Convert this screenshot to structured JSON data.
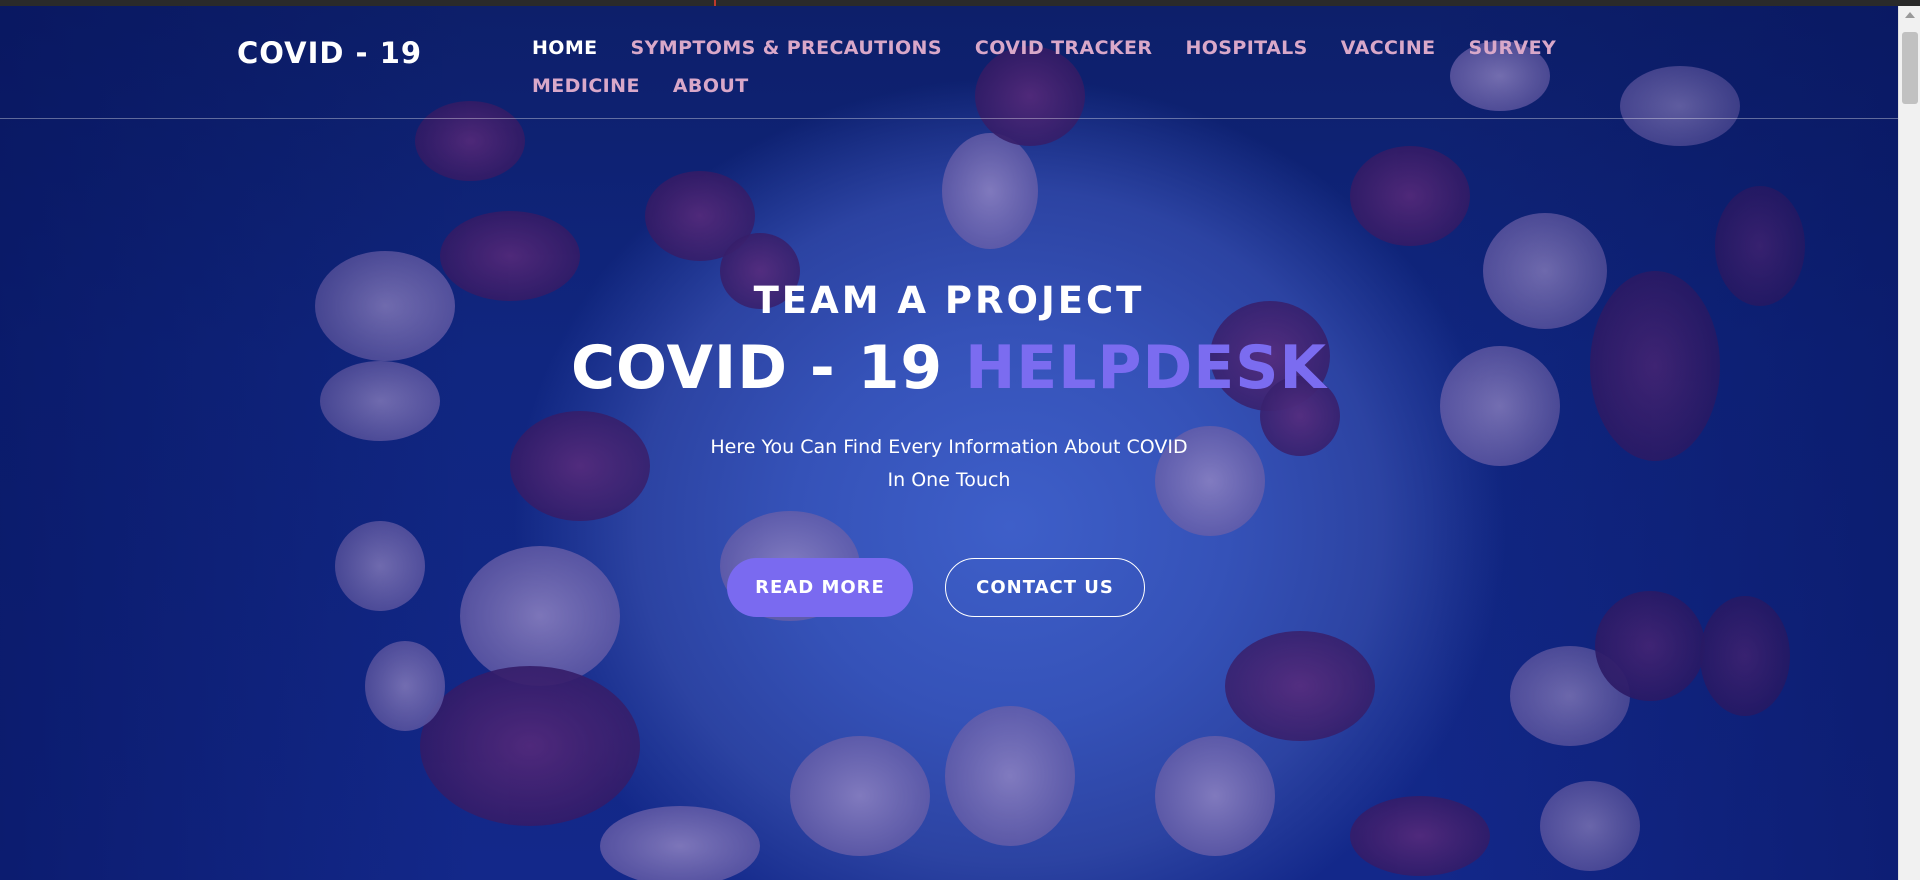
{
  "nav": {
    "brand": "COVID - 19",
    "items": [
      {
        "label": "HOME",
        "active": true
      },
      {
        "label": "SYMPTOMS & PRECAUTIONS",
        "active": false
      },
      {
        "label": "COVID TRACKER",
        "active": false
      },
      {
        "label": "HOSPITALS",
        "active": false
      },
      {
        "label": "VACCINE",
        "active": false
      },
      {
        "label": "SURVEY",
        "active": false
      },
      {
        "label": "MEDICINE",
        "active": false
      },
      {
        "label": "ABOUT",
        "active": false
      }
    ]
  },
  "hero": {
    "eyebrow": "TEAM A PROJECT",
    "headline_main": "COVID - 19 ",
    "headline_accent": "HELPDESK",
    "tagline_line1": "Here You Can Find Every Information About COVID",
    "tagline_line2": "In One Touch",
    "primary_button": "READ MORE",
    "secondary_button": "CONTACT US"
  },
  "colors": {
    "background": "#13288a",
    "accent": "#7b6cf0",
    "nav_link": "#d9a8c9",
    "nav_active": "#ffffff"
  },
  "icons": {
    "scroll_up": "chevron-up-icon"
  }
}
